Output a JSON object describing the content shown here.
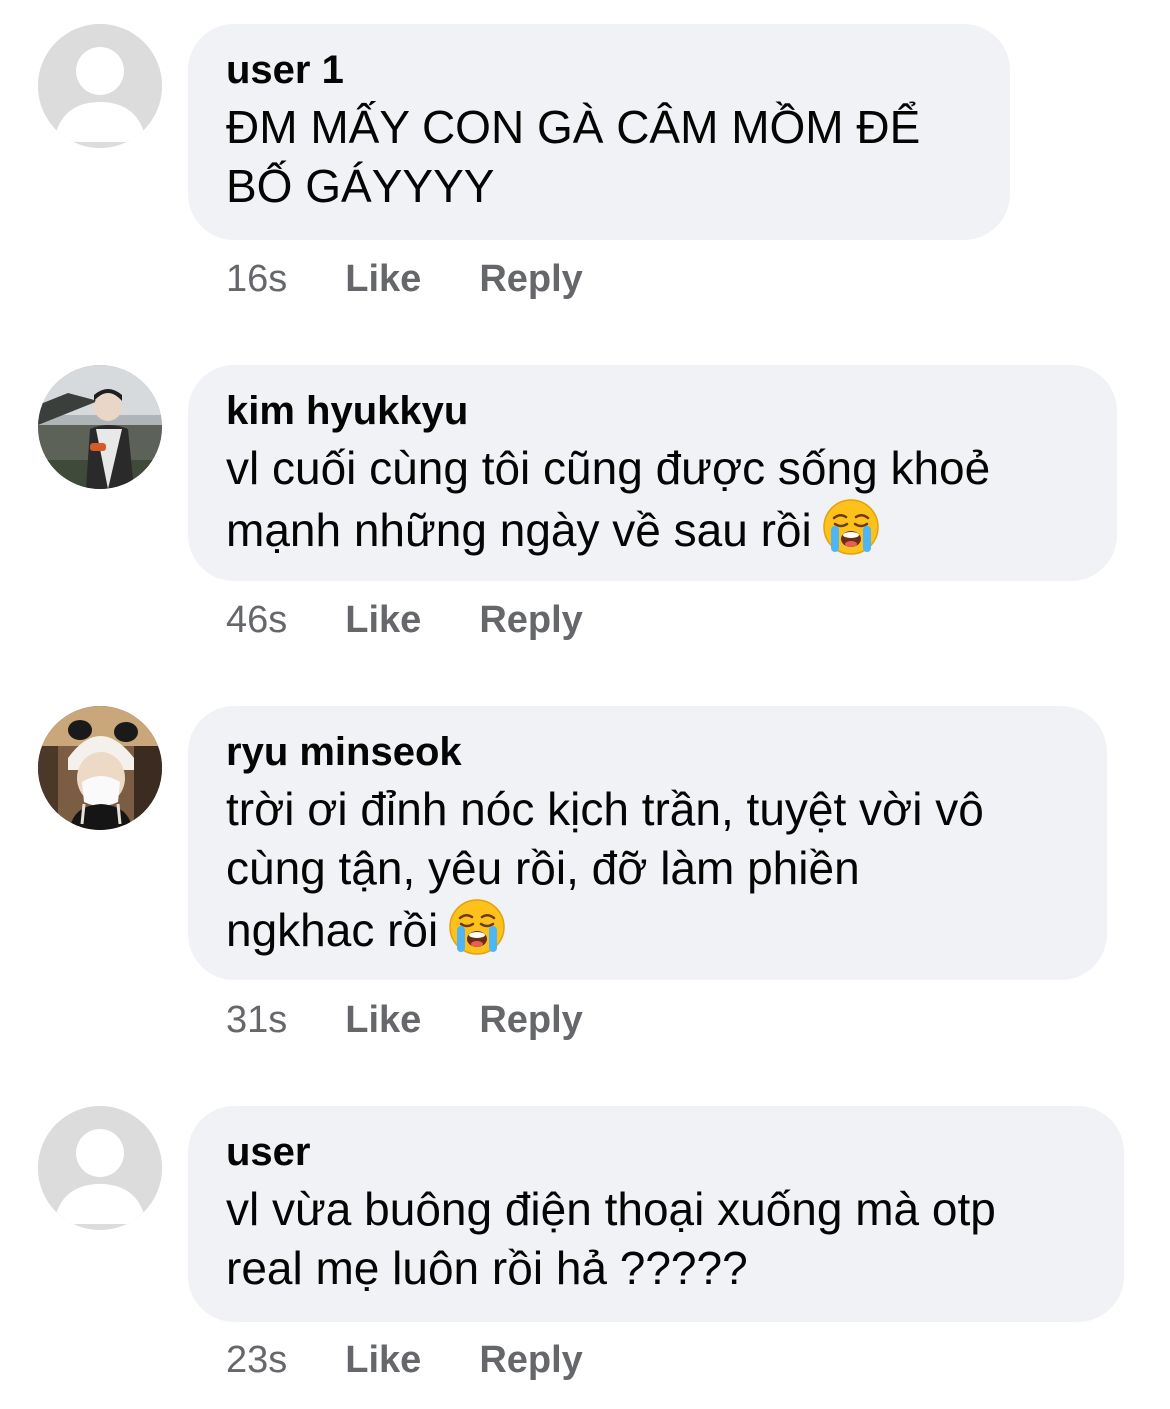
{
  "comments": [
    {
      "author": "user 1",
      "lines": [
        "ĐM MẤY CON GÀ CÂM MỒM ĐỂ",
        "BỐ GÁYYYY"
      ],
      "time": "16s",
      "like_label": "Like",
      "reply_label": "Reply",
      "avatar": "default-avatar-icon"
    },
    {
      "author": "kim hyukkyu",
      "lines": [
        "vl cuối cùng tôi cũng được sống khoẻ",
        "mạnh những ngày về sau rồi"
      ],
      "emoji": "loudly-crying-face-icon",
      "time": "46s",
      "like_label": "Like",
      "reply_label": "Reply",
      "avatar": "photo-avatar"
    },
    {
      "author": "ryu minseok",
      "lines": [
        "trời ơi đỉnh nóc kịch trần, tuyệt vời vô",
        "cùng tận, yêu rồi, đỡ làm phiền",
        "ngkhac rồi"
      ],
      "emoji": "loudly-crying-face-icon",
      "time": "31s",
      "like_label": "Like",
      "reply_label": "Reply",
      "avatar": "photo-avatar"
    },
    {
      "author": "user",
      "lines": [
        "vl vừa buông điện thoại xuống mà otp",
        "real mẹ luôn rồi hả ?????"
      ],
      "time": "23s",
      "like_label": "Like",
      "reply_label": "Reply",
      "avatar": "default-avatar-icon"
    }
  ],
  "colors": {
    "bubble_bg": "#f0f2f5",
    "meta_text": "#65676b",
    "default_avatar_bg": "#dcdcdc"
  }
}
